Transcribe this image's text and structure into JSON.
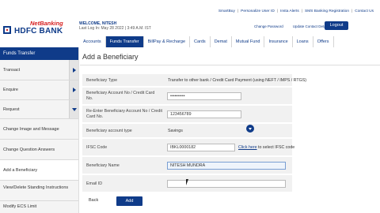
{
  "header": {
    "logo_top": "NetBanking",
    "logo_text": "HDFC BANK",
    "welcome_line1": "WELCOME, NITESH",
    "welcome_line2": "Last Log In: May 28 2022 | 3:49 A.M. IST",
    "top_links": [
      "SmartBuy",
      "Personalize User ID",
      "Insta Alerts",
      "SMS Banking Registration",
      "Contact Us"
    ],
    "sub_links": [
      "Change Password",
      "Update Contact Details"
    ],
    "logout_label": "Logout"
  },
  "nav": {
    "items": [
      "Accounts",
      "Funds Transfer",
      "BillPay & Recharge",
      "Cards",
      "Demat",
      "Mutual Fund",
      "Insurance",
      "Loans",
      "Offers"
    ],
    "active": "Funds Transfer"
  },
  "sidebar": {
    "title": "Funds Transfer",
    "items": [
      {
        "label": "Transact",
        "arrow": "right"
      },
      {
        "label": "Enquire",
        "arrow": "right"
      },
      {
        "label": "Request",
        "arrow": "down"
      },
      {
        "label": "Change Image and Message",
        "arrow": ""
      },
      {
        "label": "Change Question Answers",
        "arrow": ""
      },
      {
        "label": "Add a Beneficiary",
        "arrow": ""
      },
      {
        "label": "View/Delete Standing Instructions",
        "arrow": ""
      },
      {
        "label": "Modify ECS Limit",
        "arrow": ""
      }
    ]
  },
  "main": {
    "title": "Add a Beneficiary",
    "fields": {
      "type_label": "Beneficiary Type",
      "type_value": "Transfer to other bank / Credit Card Payment (using NEFT / IMPS / RTGS)",
      "account_label": "Beneficiary Account No / Credit Card No.",
      "account_value": "••••••••••",
      "reenter_label": "Re-Enter Beneficiary Account No / Credit Card No.",
      "reenter_value": "123456789",
      "acct_type_label": "Beneficiary account type",
      "acct_type_value": "Savings",
      "ifsc_label": "IFSC Code",
      "ifsc_value": "IBKL0000182",
      "ifsc_link": "Click here",
      "ifsc_hint": " to select IFSC code",
      "name_label": "Beneficiary Name",
      "name_value": "NITESH MUNDRA",
      "email_label": "Email ID",
      "email_value": ""
    },
    "back_label": "Back",
    "add_label": "Add"
  },
  "colors": {
    "brand": "#0f3b89",
    "accent_red": "#d61e1e"
  }
}
